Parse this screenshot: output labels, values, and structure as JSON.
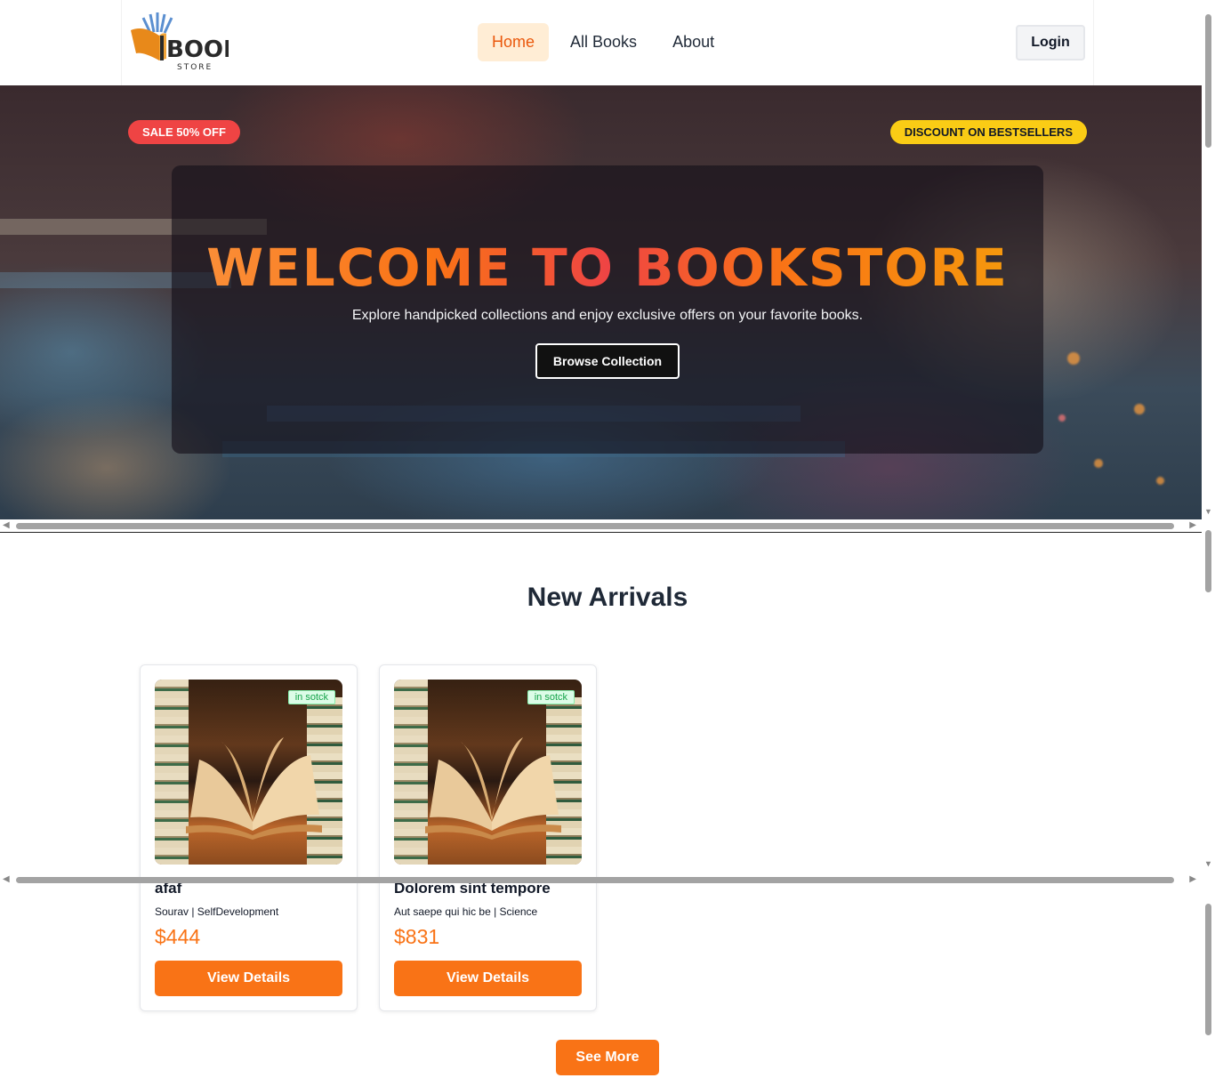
{
  "navbar": {
    "logo": {
      "word": "BOOK",
      "sub": "STORE"
    },
    "links": [
      {
        "label": "Home",
        "active": true
      },
      {
        "label": "All Books",
        "active": false
      },
      {
        "label": "About",
        "active": false
      }
    ],
    "login_label": "Login"
  },
  "hero": {
    "sale_badge": "SALE 50% OFF",
    "discount_badge": "DISCOUNT ON BESTSELLERS",
    "title": "WELCOME TO BOOKSTORE",
    "subtitle": "Explore handpicked collections and enjoy exclusive offers on your favorite books.",
    "cta_label": "Browse Collection"
  },
  "new_arrivals": {
    "title": "New Arrivals",
    "cards": [
      {
        "stock": "in sotck",
        "title": "afaf",
        "meta": "Sourav | SelfDevelopment",
        "price": "$444",
        "button": "View Details"
      },
      {
        "stock": "in sotck",
        "title": "Dolorem sint tempore",
        "meta": "Aut saepe qui hic be | Science",
        "price": "$831",
        "button": "View Details"
      }
    ],
    "see_more_label": "See More"
  },
  "colors": {
    "accent": "#f97316",
    "sale": "#ef4444",
    "discount": "#facc15",
    "stock": "#16a34a"
  }
}
